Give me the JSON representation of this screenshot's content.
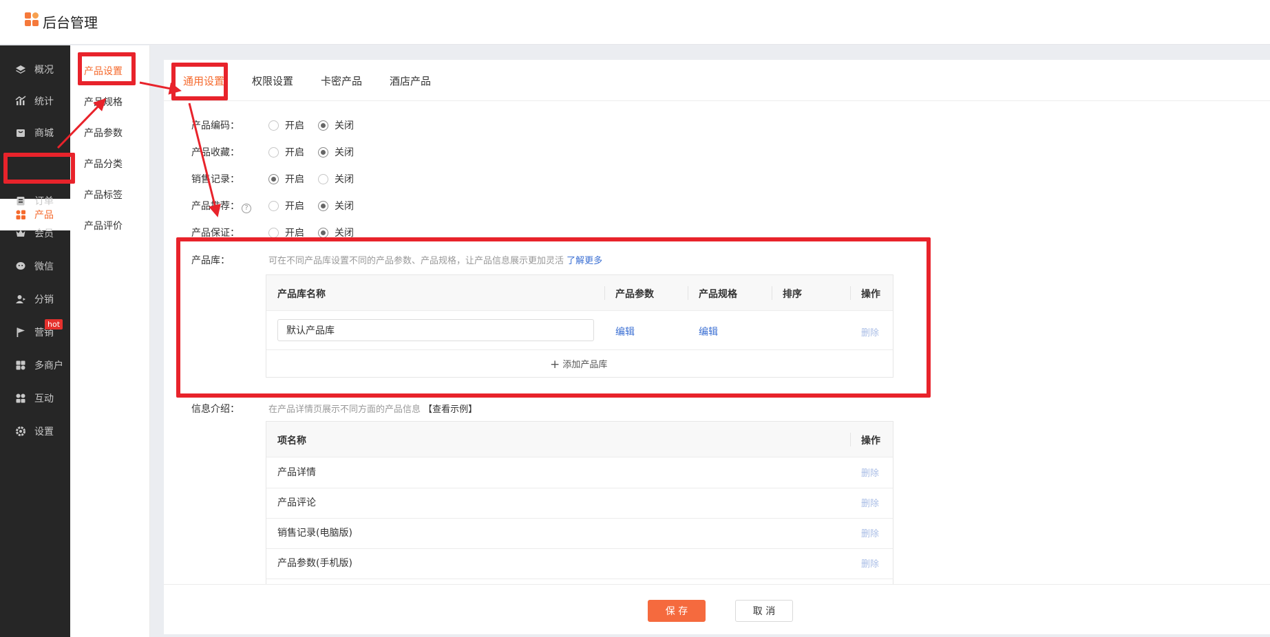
{
  "app": {
    "title": "后台管理"
  },
  "sidebar": {
    "items": [
      {
        "label": "概况",
        "icon": "layers-icon"
      },
      {
        "label": "统计",
        "icon": "chart-icon"
      },
      {
        "label": "商城",
        "icon": "store-icon"
      },
      {
        "label": "产品",
        "icon": "grid-icon",
        "active": true
      },
      {
        "label": "订单",
        "icon": "order-icon"
      },
      {
        "label": "会员",
        "icon": "crown-icon"
      },
      {
        "label": "微信",
        "icon": "wechat-icon"
      },
      {
        "label": "分销",
        "icon": "distribution-icon"
      },
      {
        "label": "营销",
        "icon": "flag-icon",
        "badge": "hot"
      },
      {
        "label": "多商户",
        "icon": "merchant-icon"
      },
      {
        "label": "互动",
        "icon": "interact-icon"
      },
      {
        "label": "设置",
        "icon": "gear-icon"
      }
    ]
  },
  "subnav": {
    "items": [
      "产品设置",
      "产品规格",
      "产品参数",
      "产品分类",
      "产品标签",
      "产品评价"
    ],
    "active_index": 0
  },
  "tabs": [
    "通用设置",
    "权限设置",
    "卡密产品",
    "酒店产品"
  ],
  "settings": {
    "on_label": "开启",
    "off_label": "关闭",
    "rows": [
      {
        "label": "产品编码：",
        "value": "off"
      },
      {
        "label": "产品收藏：",
        "value": "off"
      },
      {
        "label": "销售记录：",
        "value": "on"
      },
      {
        "label": "产品推荐：",
        "value": "off",
        "help": true
      },
      {
        "label": "产品保证：",
        "value": "off"
      }
    ]
  },
  "library": {
    "label": "产品库：",
    "hint": "可在不同产品库设置不同的产品参数、产品规格，让产品信息展示更加灵活",
    "hint_link": "了解更多",
    "columns": [
      "产品库名称",
      "产品参数",
      "产品规格",
      "排序",
      "操作"
    ],
    "rows": [
      {
        "name": "默认产品库",
        "params": "编辑",
        "specs": "编辑",
        "action": "删除"
      }
    ],
    "add_label": "添加产品库"
  },
  "info": {
    "label": "信息介绍：",
    "hint": "在产品详情页展示不同方面的产品信息",
    "hint_link": "【查看示例】",
    "columns": [
      "项名称",
      "操作"
    ],
    "delete_label": "删除",
    "rows": [
      "产品详情",
      "产品评论",
      "销售记录(电脑版)",
      "产品参数(手机版)"
    ]
  },
  "footer": {
    "save": "保 存",
    "cancel": "取 消"
  },
  "colors": {
    "accent": "#f56a2d",
    "annotation": "#e8232b",
    "sidebar_bg": "#262626",
    "link": "#3b6fd3"
  }
}
